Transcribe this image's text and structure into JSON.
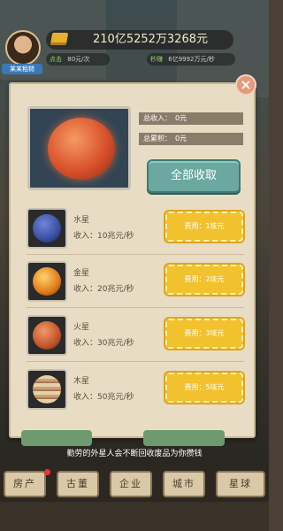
{
  "hud": {
    "avatar_tag": "某某粗糙",
    "money": "210亿5252万3268元",
    "rate_label": "点击",
    "rate_value": "80元/次",
    "income_label": "秒赚",
    "income_value": "6亿9992万元/秒"
  },
  "modal": {
    "close_label": "×",
    "total_income_label": "总收入：",
    "total_income_value": "0元",
    "total_accum_label": "总累积：",
    "total_accum_value": "0元",
    "collect_all_label": "全部收取",
    "planets": [
      {
        "name": "水星",
        "income": "收入：10兆元/秒",
        "price": "费用：1垓元",
        "icon": "mercury-icon",
        "color": "#3a4fa0"
      },
      {
        "name": "金星",
        "income": "收入：20兆元/秒",
        "price": "费用：2垓元",
        "icon": "venus-icon",
        "color": "#e07a1c"
      },
      {
        "name": "火星",
        "income": "收入：30兆元/秒",
        "price": "费用：3垓元",
        "icon": "mars-icon",
        "color": "#c2542a"
      },
      {
        "name": "木星",
        "income": "收入：50兆元/秒",
        "price": "费用：5垓元",
        "icon": "jupiter-icon",
        "color": "#c8a37a"
      }
    ]
  },
  "banner": {
    "text": "勤劳的外星人会不断回收废品为你攒钱"
  },
  "nav": {
    "items": [
      "房产",
      "古董",
      "企业",
      "城市",
      "星球"
    ]
  }
}
